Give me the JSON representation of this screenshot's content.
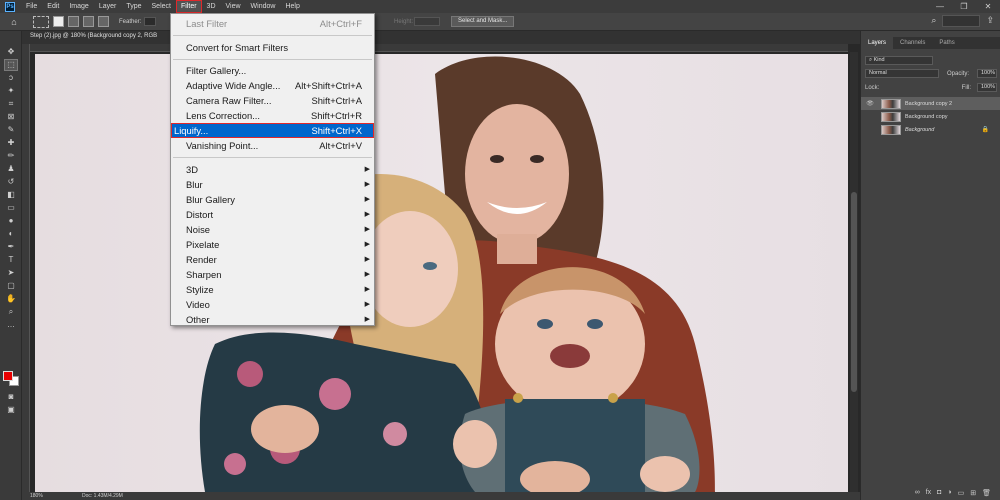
{
  "menubar": {
    "app_logo": "Ps",
    "items": [
      "File",
      "Edit",
      "Image",
      "Layer",
      "Type",
      "Select",
      "Filter",
      "3D",
      "View",
      "Window",
      "Help"
    ],
    "active_item": "Filter"
  },
  "optionsbar": {
    "feather_label": "Feather:",
    "height_label": "Height:",
    "select_mask_button": "Select and Mask..."
  },
  "document": {
    "tab_title": "Step (2).jpg @ 180% (Background copy 2, RGB",
    "zoom": "180%",
    "doc_size": "Doc: 1.43M/4.29M"
  },
  "filter_menu": {
    "items": [
      {
        "label": "Last Filter",
        "shortcut": "Alt+Ctrl+F",
        "disabled": true
      },
      {
        "label": "Convert for Smart Filters",
        "shortcut": ""
      },
      {
        "label": "Filter Gallery...",
        "shortcut": ""
      },
      {
        "label": "Adaptive Wide Angle...",
        "shortcut": "Alt+Shift+Ctrl+A"
      },
      {
        "label": "Camera Raw Filter...",
        "shortcut": "Shift+Ctrl+A"
      },
      {
        "label": "Lens Correction...",
        "shortcut": "Shift+Ctrl+R"
      },
      {
        "label": "Liquify...",
        "shortcut": "Shift+Ctrl+X",
        "highlighted": true
      },
      {
        "label": "Vanishing Point...",
        "shortcut": "Alt+Ctrl+V"
      },
      {
        "label": "3D",
        "submenu": true
      },
      {
        "label": "Blur",
        "submenu": true
      },
      {
        "label": "Blur Gallery",
        "submenu": true
      },
      {
        "label": "Distort",
        "submenu": true
      },
      {
        "label": "Noise",
        "submenu": true
      },
      {
        "label": "Pixelate",
        "submenu": true
      },
      {
        "label": "Render",
        "submenu": true
      },
      {
        "label": "Sharpen",
        "submenu": true
      },
      {
        "label": "Stylize",
        "submenu": true
      },
      {
        "label": "Video",
        "submenu": true
      },
      {
        "label": "Other",
        "submenu": true
      }
    ]
  },
  "panel": {
    "tabs": [
      "Layers",
      "Channels",
      "Paths"
    ],
    "active_tab": "Layers",
    "kind_filter": "Kind",
    "blend_mode": "Normal",
    "opacity_label": "Opacity:",
    "opacity_value": "100%",
    "lock_label": "Lock:",
    "fill_label": "Fill:",
    "fill_value": "100%",
    "layers": [
      {
        "name": "Background copy 2",
        "visible": true,
        "selected": true
      },
      {
        "name": "Background copy",
        "visible": false,
        "selected": false
      },
      {
        "name": "Background",
        "visible": false,
        "selected": false,
        "locked": true
      }
    ]
  },
  "colors": {
    "foreground": "#e80000",
    "background": "#ffffff",
    "menu_highlight": "#0066cc",
    "highlight_border": "#e0282b"
  }
}
